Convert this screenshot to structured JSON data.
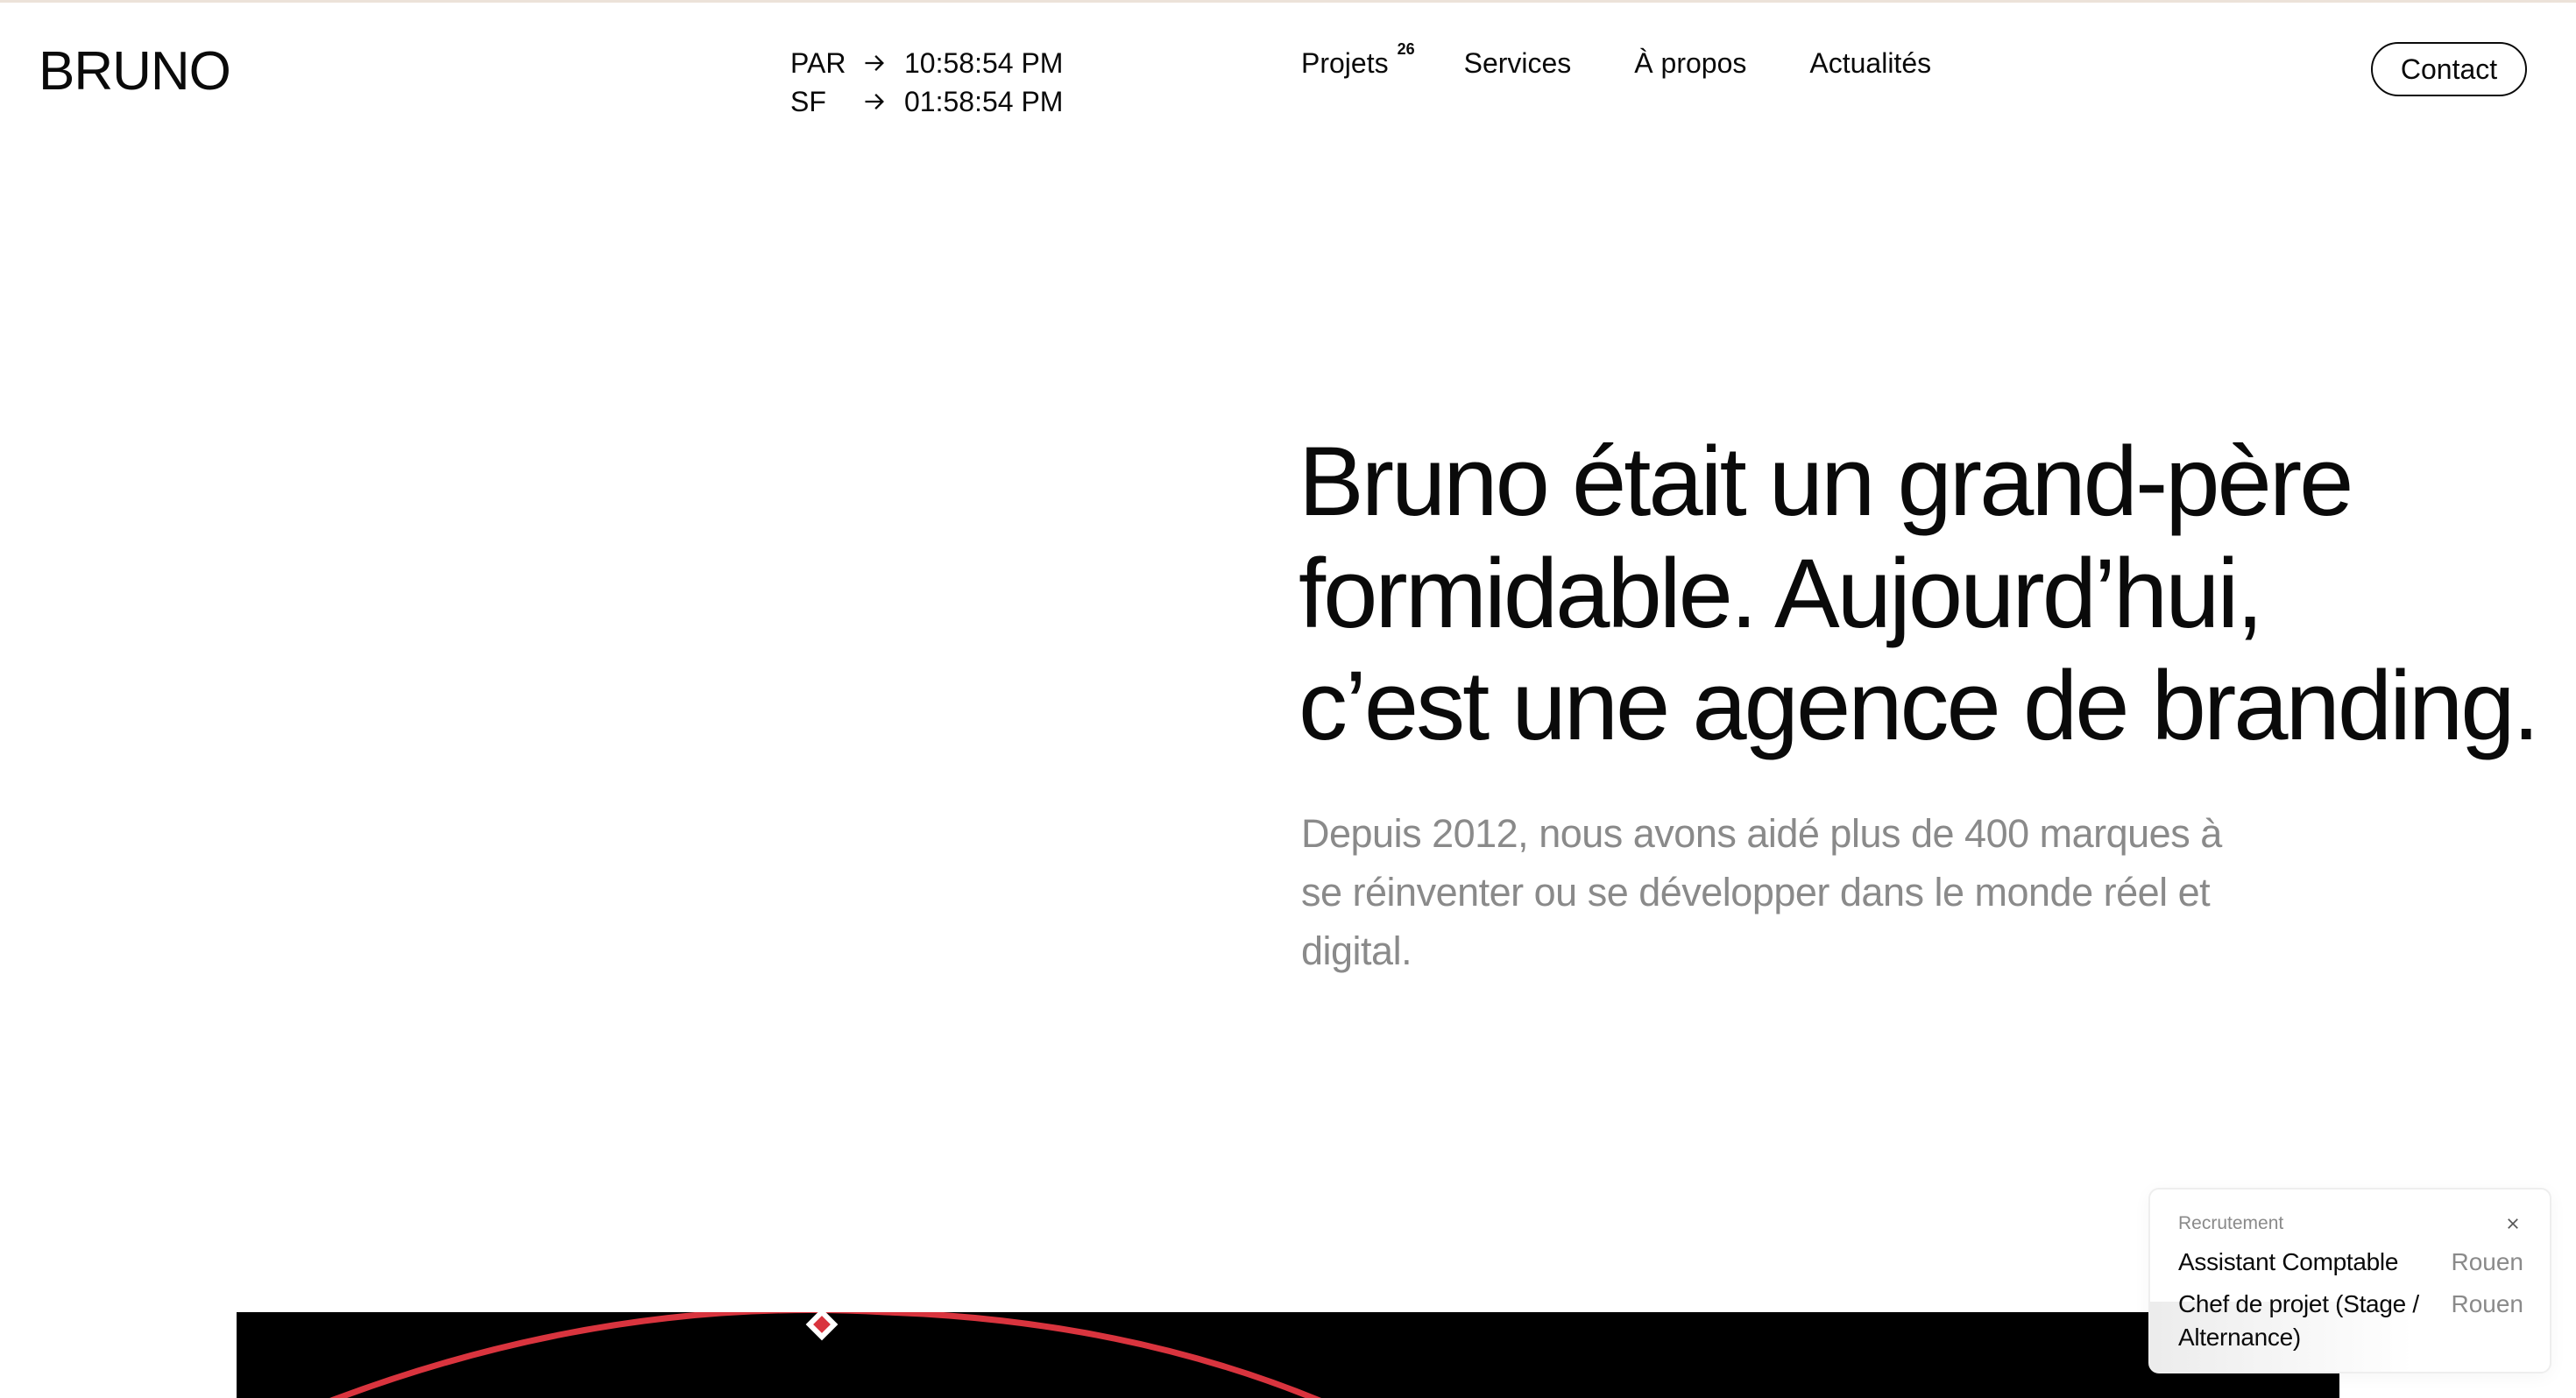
{
  "header": {
    "logo": "BRUNO",
    "clocks": [
      {
        "city": "PAR",
        "time": "10:58:54 PM"
      },
      {
        "city": "SF",
        "time": "01:58:54 PM"
      }
    ],
    "nav": [
      {
        "label": "Projets",
        "sup": "26"
      },
      {
        "label": "Services"
      },
      {
        "label": "À propos"
      },
      {
        "label": "Actualités"
      }
    ],
    "contact_label": "Contact"
  },
  "hero": {
    "heading_lines": [
      "Bruno était un grand-père",
      "formidable. Aujourd’hui,",
      "c’est une agence de branding."
    ],
    "subtitle": "Depuis 2012, nous avons aidé plus de 400 marques à se réinventer ou se développer dans le monde réel et digital."
  },
  "recruitment": {
    "title": "Recrutement",
    "jobs": [
      {
        "title": "Assistant Comptable",
        "city": "Rouen"
      },
      {
        "title": "Chef de projet (Stage / Alternance)",
        "city": "Rouen"
      }
    ]
  },
  "colors": {
    "text": "#0a0a0a",
    "muted": "#8a8a8a",
    "accent_red": "#d9343e",
    "media_bg": "#000000"
  }
}
